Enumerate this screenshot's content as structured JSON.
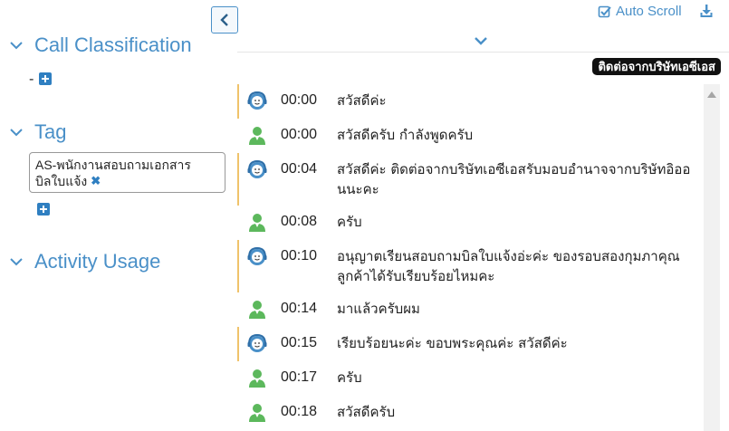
{
  "left": {
    "sections": {
      "call_classification": {
        "title": "Call Classification",
        "value": "-"
      },
      "tag": {
        "title": "Tag",
        "tag_line1": "AS-พนักงานสอบถามเอกสาร",
        "tag_line2": "บิลใบแจ้ง"
      },
      "activity_usage": {
        "title": "Activity Usage"
      }
    },
    "icons": {
      "collapse": "chevron-left-icon",
      "add": "plus-square-icon",
      "remove": "times-icon",
      "section": "chevron-down-icon"
    }
  },
  "right": {
    "auto_scroll_label": "Auto Scroll",
    "auto_scroll_checked": true,
    "company_label": "ติดต่อจากบริษัทเอซีเอส",
    "messages": [
      {
        "speaker": "agent",
        "time": "00:00",
        "text": "สวัสดีค่ะ"
      },
      {
        "speaker": "customer",
        "time": "00:00",
        "text": "สวัสดีครับ กำลังพูดครับ"
      },
      {
        "speaker": "agent",
        "time": "00:04",
        "text": "สวัสดีค่ะ ติดต่อจากบริษัทเอซีเอสรับมอบอำนาจจากบริษัทอิออนนะคะ"
      },
      {
        "speaker": "customer",
        "time": "00:08",
        "text": "ครับ"
      },
      {
        "speaker": "agent",
        "time": "00:10",
        "text": "อนุญาตเรียนสอบถามบิลใบแจ้งอ่ะค่ะ ของรอบสองกุมภาคุณลูกค้าได้รับเรียบร้อยไหมคะ"
      },
      {
        "speaker": "customer",
        "time": "00:14",
        "text": "มาแล้วครับผม"
      },
      {
        "speaker": "agent",
        "time": "00:15",
        "text": "เรียบร้อยนะค่ะ ขอบพระคุณค่ะ สวัสดีค่ะ"
      },
      {
        "speaker": "customer",
        "time": "00:17",
        "text": "ครับ"
      },
      {
        "speaker": "customer",
        "time": "00:18",
        "text": "สวัสดีครับ"
      }
    ]
  },
  "colors": {
    "accent": "#4a90c8",
    "button_blue": "#2f7fc1",
    "agent_marker": "#f0c36b",
    "customer_green": "#5cb85c"
  }
}
